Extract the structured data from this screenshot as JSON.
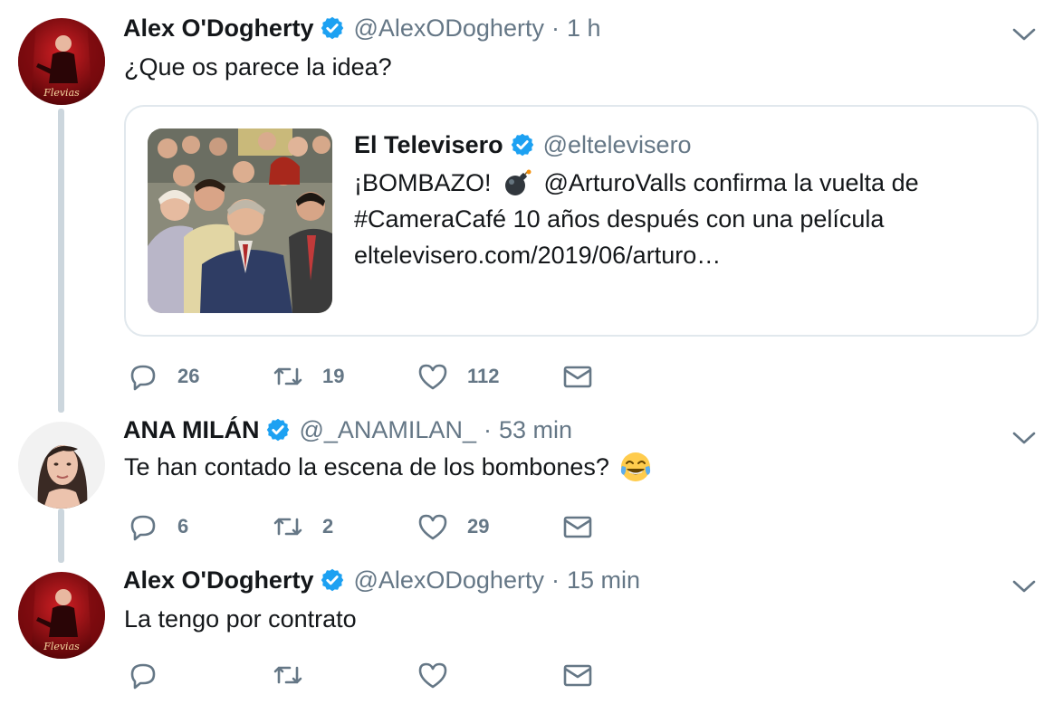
{
  "colors": {
    "text": "#14171a",
    "muted": "#657786",
    "verified": "#1da1f2",
    "thread_line": "#ccd6dd",
    "border": "#e1e8ed"
  },
  "tweets": [
    {
      "name": "Alex O'Dogherty",
      "handle": "@AlexODogherty",
      "separator": "·",
      "time": "1 h",
      "text": "¿Que os parece la idea?",
      "replies": "26",
      "retweets": "19",
      "likes": "112",
      "quote": {
        "name": "El Televisero",
        "handle": "@eltelevisero",
        "line1_a": "¡BOMBAZO!",
        "line1_b": "@ArturoValls confirma la vuelta de",
        "line2": "#CameraCafé 10 años después con una película",
        "line3": "eltelevisero.com/2019/06/arturo…"
      }
    },
    {
      "name": "ANA MILÁN",
      "handle": "@_ANAMILAN_",
      "separator": "·",
      "time": "53 min",
      "text": "Te han contado la escena de los bombones?",
      "replies": "6",
      "retweets": "2",
      "likes": "29"
    },
    {
      "name": "Alex O'Dogherty",
      "handle": "@AlexODogherty",
      "separator": "·",
      "time": "15 min",
      "text": "La tengo por contrato",
      "replies": "",
      "retweets": "",
      "likes": ""
    }
  ],
  "icons": {
    "verified": "verified-badge-icon",
    "chevron": "chevron-down-icon",
    "reply": "reply-icon",
    "retweet": "retweet-icon",
    "like": "heart-icon",
    "dm": "envelope-icon",
    "bomb": "bomb-emoji",
    "laugh": "tears-of-joy-emoji"
  }
}
